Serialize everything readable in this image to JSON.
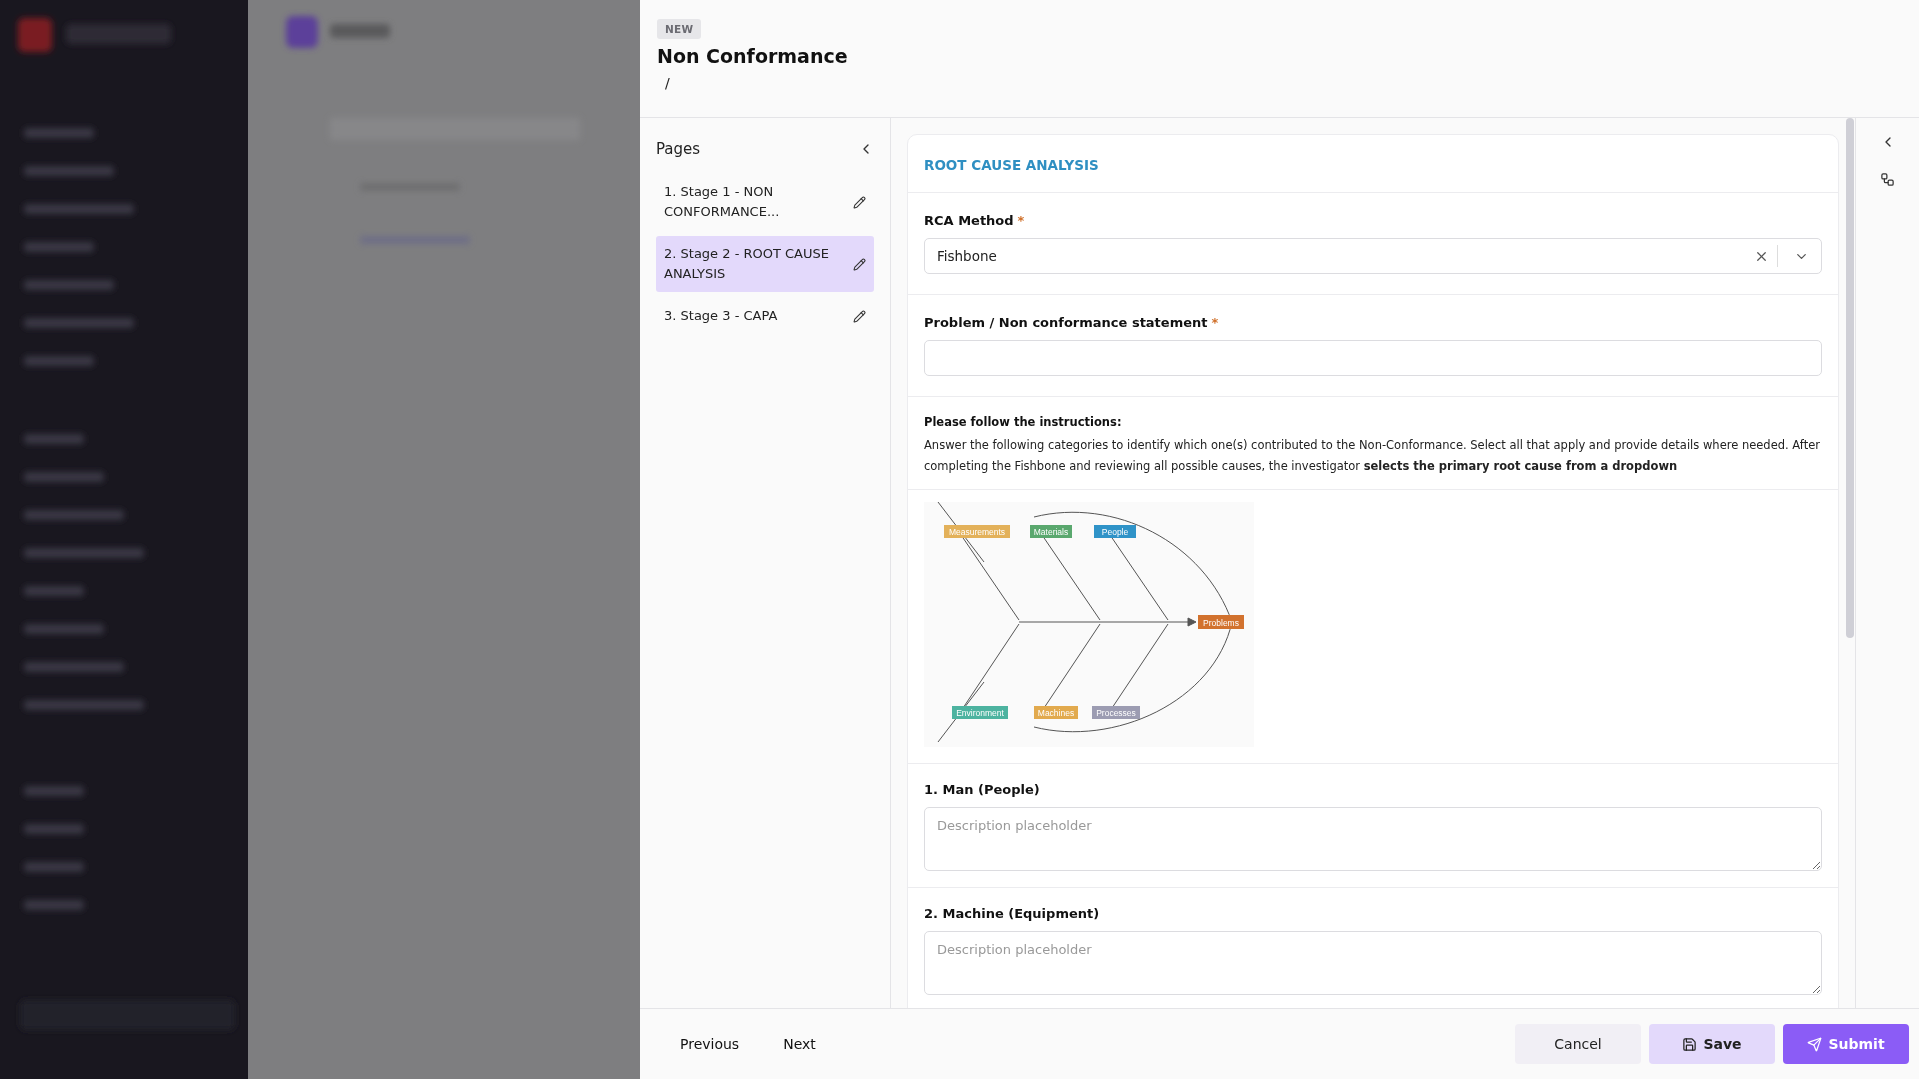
{
  "drawer": {
    "badge": "NEW",
    "title": "Non Conformance",
    "breadcrumb": "/"
  },
  "pages": {
    "title": "Pages",
    "items": [
      {
        "label": "1. Stage 1 - NON CONFORMANCE...",
        "selected": false
      },
      {
        "label": "2. Stage 2 - ROOT CAUSE ANALYSIS",
        "selected": true
      },
      {
        "label": "3. Stage 3 - CAPA",
        "selected": false
      }
    ]
  },
  "form": {
    "section_title": "ROOT CAUSE ANALYSIS",
    "fields": [
      {
        "kind": "select",
        "label": "RCA Method",
        "required_mark": "*",
        "value": "Fishbone"
      },
      {
        "kind": "text",
        "label": "Problem / Non conformance statement",
        "required_mark": "*"
      },
      {
        "kind": "instructions",
        "heading": "Please follow the instructions:",
        "body": "Answer the following categories to identify which one(s) contributed to the Non-Conformance. Select all that apply and provide details where needed. After completing the Fishbone and reviewing all possible causes, the investigator **selects the primary root cause from a dropdown**"
      },
      {
        "kind": "diagram",
        "effect": {
          "label": "Problems",
          "color": "#d2722e"
        },
        "categories": [
          {
            "label": "Measurements",
            "color": "#e3b15a"
          },
          {
            "label": "Materials",
            "color": "#5aa86e"
          },
          {
            "label": "People",
            "color": "#2f93c8"
          },
          {
            "label": "Environment",
            "color": "#4db3a0"
          },
          {
            "label": "Machines",
            "color": "#e2aa4e"
          },
          {
            "label": "Processes",
            "color": "#9c9cb2"
          }
        ]
      },
      {
        "kind": "textarea",
        "label": "1. Man (People)",
        "placeholder": "Description placeholder"
      },
      {
        "kind": "textarea",
        "label": "2. Machine (Equipment)",
        "placeholder": "Description placeholder"
      }
    ]
  },
  "footer": {
    "nav": [
      "Previous",
      "Next"
    ],
    "actions": [
      {
        "label": "Cancel",
        "kind": "plain"
      },
      {
        "label": "Save",
        "kind": "soft"
      },
      {
        "label": "Submit",
        "kind": "primary"
      }
    ]
  }
}
